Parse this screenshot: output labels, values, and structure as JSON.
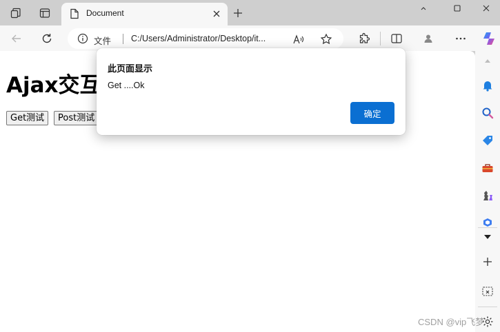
{
  "browser": {
    "tab": {
      "title": "Document",
      "icon": "document-icon"
    },
    "address": {
      "security_label": "文件",
      "url": "C:/Users/Administrator/Desktop/it..."
    },
    "icons": {
      "workspaces": "workspaces-icon",
      "tab_actions": "tab-actions-icon",
      "back": "back-arrow-icon",
      "refresh": "refresh-icon",
      "read_aloud": "read-aloud-icon",
      "favorite": "star-icon",
      "extensions": "puzzle-icon",
      "split_screen": "split-screen-icon",
      "profile": "profile-icon",
      "more": "more-dots-icon",
      "copilot": "copilot-icon"
    }
  },
  "page": {
    "heading": "Ajax交互",
    "buttons": [
      {
        "label": "Get测试"
      },
      {
        "label": "Post测试"
      }
    ]
  },
  "dialog": {
    "title": "此页面显示",
    "message": "Get ....Ok",
    "ok_label": "确定"
  },
  "sidebar": {
    "items": [
      "bell-icon",
      "search-icon",
      "tag-icon",
      "toolbox-icon",
      "chess-icon",
      "office-icon"
    ],
    "bottom": [
      "add-icon",
      "screenshot-icon",
      "settings-icon"
    ]
  },
  "watermark": "CSDN @vip飞梦",
  "colors": {
    "accent": "#0b6fd2",
    "chrome": "#cfcfcf",
    "toolbar": "#f7f7f7"
  }
}
